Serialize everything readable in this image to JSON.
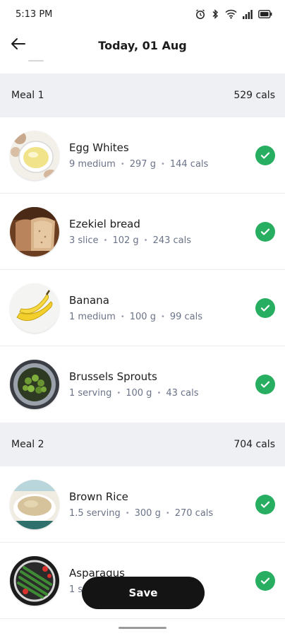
{
  "status_bar": {
    "time": "5:13 PM",
    "icons": [
      "alarm-icon",
      "bluetooth-icon",
      "wifi-icon",
      "signal-icon",
      "battery-icon"
    ]
  },
  "header": {
    "title": "Today, 01 Aug",
    "back_icon": "arrow-left-icon"
  },
  "meals": [
    {
      "label": "Meal 1",
      "calories": "529 cals",
      "items": [
        {
          "name": "Egg Whites",
          "quantity": "9 medium",
          "weight": "297 g",
          "calories": "144 cals",
          "checked": true
        },
        {
          "name": "Ezekiel bread",
          "quantity": "3 slice",
          "weight": "102 g",
          "calories": "243 cals",
          "checked": true
        },
        {
          "name": "Banana",
          "quantity": "1 medium",
          "weight": "100 g",
          "calories": "99 cals",
          "checked": true
        },
        {
          "name": "Brussels Sprouts",
          "quantity": "1 serving",
          "weight": "100 g",
          "calories": "43 cals",
          "checked": true
        }
      ]
    },
    {
      "label": "Meal 2",
      "calories": "704 cals",
      "items": [
        {
          "name": "Brown Rice",
          "quantity": "1.5 serving",
          "weight": "300 g",
          "calories": "270 cals",
          "checked": true
        },
        {
          "name": "Asparagus",
          "quantity": "1 s",
          "weight": "",
          "calories": "",
          "checked": true
        }
      ]
    }
  ],
  "save_button": {
    "label": "Save"
  },
  "colors": {
    "accent_check": "#27ae60",
    "meal_header_bg": "#eef0f4",
    "save_button_bg": "#141414",
    "meta_text": "#6b7388"
  }
}
